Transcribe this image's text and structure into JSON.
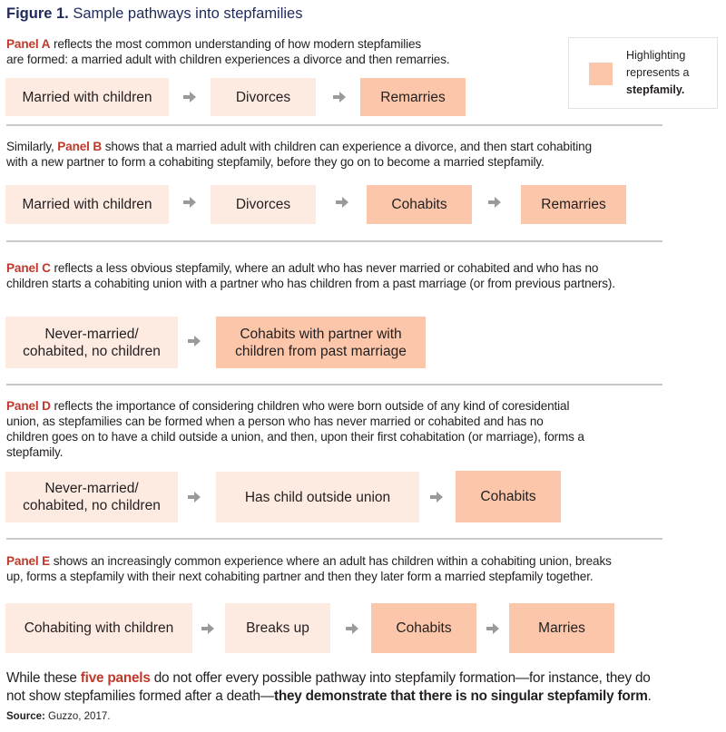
{
  "figure": {
    "label": "Figure 1.",
    "title": "Sample pathways into stepfamilies"
  },
  "legend": {
    "line1": "Highlighting",
    "line2": "represents a",
    "line3": "stepfamily.",
    "swatch_color": "#fbc6a9"
  },
  "colors": {
    "non_stepfamily": "#fdebe2",
    "stepfamily": "#fbc6a9",
    "panel_accent": "#c0392b",
    "title": "#1f2a5a",
    "arrow": "#9a9a9a"
  },
  "panels": [
    {
      "name": "Panel A",
      "text_line1": " reflects the most common understanding of how modern stepfamilies",
      "text_line2": "are formed: a married adult with children experiences a divorce and then remarries.",
      "steps": [
        {
          "label": "Married with children",
          "stepfamily": false
        },
        {
          "label": "Divorces",
          "stepfamily": false
        },
        {
          "label": "Remarries",
          "stepfamily": true
        }
      ]
    },
    {
      "prefix": "Similarly, ",
      "name": "Panel B",
      "text_line1": " shows that a married adult with children can experience a divorce, and then start cohabiting",
      "text_line2": "with a new partner to form a cohabiting stepfamily, before they go on to become a married stepfamily.",
      "steps": [
        {
          "label": "Married with children",
          "stepfamily": false
        },
        {
          "label": "Divorces",
          "stepfamily": false
        },
        {
          "label": "Cohabits",
          "stepfamily": true
        },
        {
          "label": "Remarries",
          "stepfamily": true
        }
      ]
    },
    {
      "name": "Panel C",
      "text_line1": " reflects a less obvious stepfamily, where an adult who has never married or cohabited and who has no",
      "text_line2": "children starts a cohabiting union with a partner who has children from a past marriage (or from previous partners).",
      "steps": [
        {
          "label_line1": "Never-married/",
          "label_line2": "cohabited, no children",
          "stepfamily": false
        },
        {
          "label_line1": "Cohabits with partner with",
          "label_line2": "children from past marriage",
          "stepfamily": true
        }
      ]
    },
    {
      "name": "Panel D",
      "text_line1": " reflects the importance of considering children who were born outside of any kind of coresidential",
      "text_line2": "union, as stepfamilies can be formed when a person who has never married or cohabited and has no",
      "text_line3": "children goes on to have a child outside a union, and then, upon their first cohabitation (or marriage), forms a",
      "text_line4": "stepfamily.",
      "steps": [
        {
          "label_line1": "Never-married/",
          "label_line2": "cohabited, no children",
          "stepfamily": false
        },
        {
          "label": "Has child outside union",
          "stepfamily": false
        },
        {
          "label": "Cohabits",
          "stepfamily": true
        }
      ]
    },
    {
      "name": "Panel E",
      "text_line1": " shows an increasingly common experience where an adult has children within a cohabiting union, breaks",
      "text_line2": "up, forms a stepfamily with their next cohabiting partner and then they later form a married stepfamily together.",
      "steps": [
        {
          "label": "Cohabiting with children",
          "stepfamily": false
        },
        {
          "label": "Breaks up",
          "stepfamily": false
        },
        {
          "label": "Cohabits",
          "stepfamily": true
        },
        {
          "label": "Marries",
          "stepfamily": true
        }
      ]
    }
  ],
  "conclusion": {
    "part1": "While these ",
    "highlight": "five panels",
    "part2": " do not offer every possible pathway into stepfamily formation—for instance, they do",
    "part3": "not show stepfamilies formed after a death—",
    "bold": "they demonstrate that there is no singular stepfamily form",
    "end": "."
  },
  "source": {
    "label": "Source:",
    "text": " Guzzo, 2017."
  }
}
